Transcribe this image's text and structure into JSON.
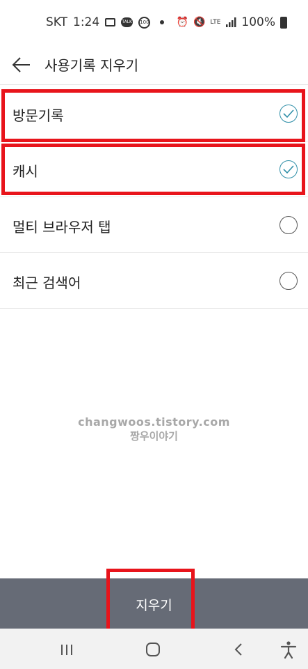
{
  "status_bar": {
    "carrier": "SKT",
    "time": "1:24",
    "network": "LTE",
    "battery": "100%",
    "icons": [
      "gallery-icon",
      "talk-icon",
      "badge-100-icon",
      "dot-icon",
      "alarm-icon",
      "mute-icon",
      "lte-icon",
      "signal-icon",
      "battery-icon"
    ],
    "talk_text": "TALK",
    "badge_text": "100"
  },
  "header": {
    "title": "사용기록 지우기",
    "back_icon": "back-arrow-icon"
  },
  "options": [
    {
      "label": "방문기록",
      "checked": true
    },
    {
      "label": "캐시",
      "checked": true
    },
    {
      "label": "멀티 브라우저 탭",
      "checked": false
    },
    {
      "label": "최근 검색어",
      "checked": false
    }
  ],
  "watermark": {
    "line1": "changwoos.tistory.com",
    "line2": "짱우이야기"
  },
  "action": {
    "clear_label": "지우기"
  },
  "nav": {
    "icons": [
      "recents-icon",
      "home-icon",
      "back-icon",
      "accessibility-icon"
    ]
  },
  "colors": {
    "accent_check": "#2f8fa8",
    "highlight": "#e8141b",
    "action_bar": "#666b76"
  }
}
